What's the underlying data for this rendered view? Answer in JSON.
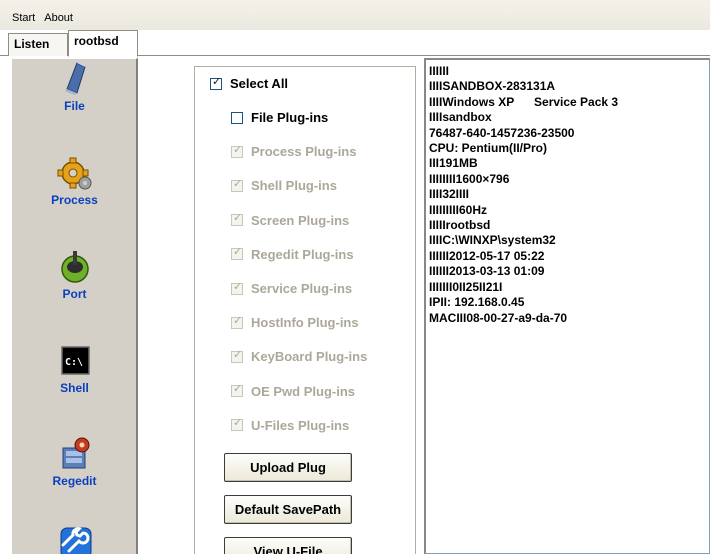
{
  "menu": {
    "items": [
      "Start",
      "About"
    ]
  },
  "tabs": [
    "Listen",
    "rootbsd"
  ],
  "sidebar": {
    "items": [
      {
        "label": "File",
        "icon": "book-icon"
      },
      {
        "label": "Process",
        "icon": "gears-icon"
      },
      {
        "label": "Port",
        "icon": "power-plug-icon"
      },
      {
        "label": "Shell",
        "icon": "command-prompt-icon"
      },
      {
        "label": "Regedit",
        "icon": "registry-icon"
      },
      {
        "label": "",
        "icon": "wrench-icon"
      }
    ]
  },
  "plugins": {
    "select_all": {
      "label": "Select All",
      "checked": true,
      "enabled": true
    },
    "items": [
      {
        "label": "File Plug-ins",
        "checked": false,
        "enabled": true
      },
      {
        "label": "Process Plug-ins",
        "checked": true,
        "enabled": false
      },
      {
        "label": "Shell Plug-ins",
        "checked": true,
        "enabled": false
      },
      {
        "label": "Screen Plug-ins",
        "checked": true,
        "enabled": false
      },
      {
        "label": "Regedit Plug-ins",
        "checked": true,
        "enabled": false
      },
      {
        "label": "Service Plug-ins",
        "checked": true,
        "enabled": false
      },
      {
        "label": "HostInfo Plug-ins",
        "checked": true,
        "enabled": false
      },
      {
        "label": "KeyBoard Plug-ins",
        "checked": true,
        "enabled": false
      },
      {
        "label": "OE Pwd Plug-ins",
        "checked": true,
        "enabled": false
      },
      {
        "label": "U-Files Plug-ins",
        "checked": true,
        "enabled": false
      }
    ],
    "buttons": [
      "Upload Plug",
      "Default SavePath",
      "View U-File"
    ]
  },
  "info": {
    "lines": [
      "IIIIII",
      "IIIISANDBOX-283131A",
      "IIIIWindows XP      Service Pack 3",
      "IIIIsandbox",
      "76487-640-1457236-23500",
      "CPU: Pentium(II/Pro)",
      "III191MB",
      "IIIIIIII1600×796",
      "IIII32IIII",
      "IIIIIIIII60Hz",
      "IIIIIrootbsd",
      "IIIIC:\\WINXP\\system32",
      "IIIIII2012-05-17 05:22",
      "IIIIII2013-03-13 01:09",
      "IIIIIII0II25II21I",
      "IPII: 192.168.0.45",
      "MACIII08-00-27-a9-da-70"
    ]
  },
  "colors": {
    "sidebar_bg": "#d4d0c8",
    "sidebar_label": "#0a3fbd",
    "disabled_text": "#aca899"
  }
}
